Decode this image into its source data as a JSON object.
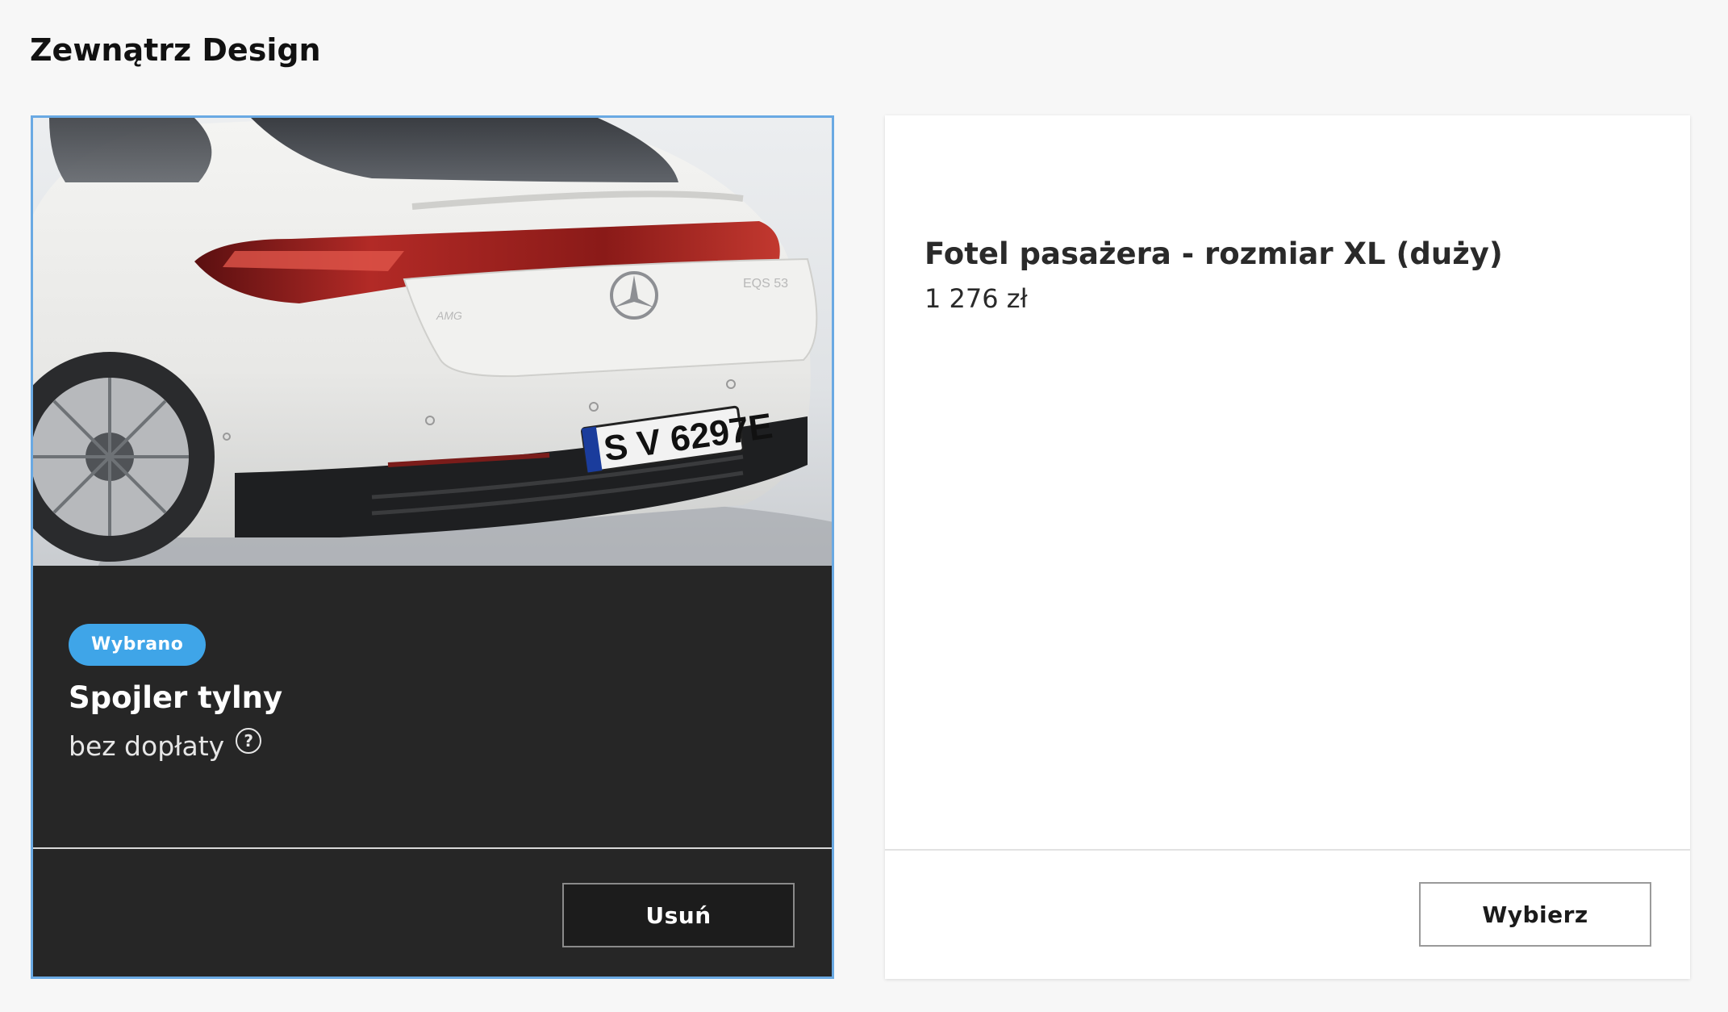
{
  "section": {
    "title": "Zewnątrz Design"
  },
  "cards": [
    {
      "selected": true,
      "badge": "Wybrano",
      "title": "Spojler tylny",
      "price": "bez dopłaty",
      "help_icon": "question-circle-icon",
      "action_label": "Usuń",
      "image": {
        "description_icon": "car-rear-image",
        "plate_text": "S V 6297E",
        "model_badge": "EQS 53"
      }
    },
    {
      "selected": false,
      "title": "Fotel pasażera - rozmiar XL (duży)",
      "price": "1 276 zł",
      "action_label": "Wybierz"
    }
  ],
  "colors": {
    "selected_border": "#6aa9e3",
    "badge_bg": "#3fa5e8",
    "dark_card_bg": "#262626",
    "page_bg": "#f7f7f7"
  }
}
